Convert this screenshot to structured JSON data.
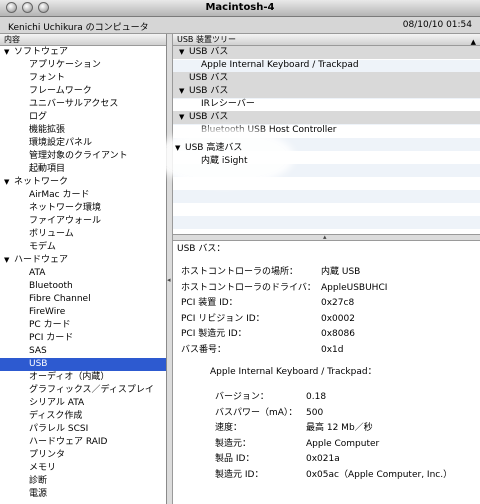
{
  "window": {
    "title": "Macintosh-4"
  },
  "info": {
    "computer_name": "Kenichi Uchikura のコンピュータ",
    "datetime": "08/10/10 01:54"
  },
  "sidebar": {
    "header": "内容",
    "rows": [
      {
        "label": "ソフトウェア",
        "cat": true
      },
      {
        "label": "アプリケーション"
      },
      {
        "label": "フォント"
      },
      {
        "label": "フレームワーク"
      },
      {
        "label": "ユニバーサルアクセス"
      },
      {
        "label": "ログ"
      },
      {
        "label": "機能拡張"
      },
      {
        "label": "環境設定パネル"
      },
      {
        "label": "管理対象のクライアント"
      },
      {
        "label": "起動項目"
      },
      {
        "label": "ネットワーク",
        "cat": true
      },
      {
        "label": "AirMac カード"
      },
      {
        "label": "ネットワーク環境"
      },
      {
        "label": "ファイアウォール"
      },
      {
        "label": "ボリューム"
      },
      {
        "label": "モデム"
      },
      {
        "label": "ハードウェア",
        "cat": true
      },
      {
        "label": "ATA"
      },
      {
        "label": "Bluetooth"
      },
      {
        "label": "Fibre Channel"
      },
      {
        "label": "FireWire"
      },
      {
        "label": "PC カード"
      },
      {
        "label": "PCI カード"
      },
      {
        "label": "SAS"
      },
      {
        "label": "USB",
        "selected": true
      },
      {
        "label": "オーディオ（内蔵）"
      },
      {
        "label": "グラフィックス／ディスプレイ"
      },
      {
        "label": "シリアル ATA"
      },
      {
        "label": "ディスク作成"
      },
      {
        "label": "パラレル SCSI"
      },
      {
        "label": "ハードウェア RAID"
      },
      {
        "label": "プリンタ"
      },
      {
        "label": "メモリ"
      },
      {
        "label": "診断"
      },
      {
        "label": "電源"
      }
    ]
  },
  "usb_tree": {
    "header": "USB 装置ツリー",
    "rows": [
      {
        "label": "USB バス",
        "type": "bus",
        "expanded": true
      },
      {
        "label": "Apple Internal Keyboard / Trackpad",
        "type": "dev"
      },
      {
        "label": "USB バス",
        "type": "bus",
        "expanded": false
      },
      {
        "label": "USB バス",
        "type": "bus",
        "expanded": true
      },
      {
        "label": "IRレシーバー",
        "type": "dev"
      },
      {
        "label": "USB バス",
        "type": "bus",
        "expanded": true
      },
      {
        "label": "Bluetooth USB Host Controller",
        "type": "dev"
      }
    ],
    "highlight": {
      "bus": "USB 高速バス",
      "device": "内蔵 iSight"
    }
  },
  "details": {
    "title": "USB バス：",
    "bus_props": [
      {
        "k": "ホストコントローラの場所：",
        "v": "内蔵 USB"
      },
      {
        "k": "ホストコントローラのドライバ：",
        "v": "AppleUSBUHCI"
      },
      {
        "k": "PCI 装置 ID：",
        "v": "0x27c8"
      },
      {
        "k": "PCI リビジョン ID：",
        "v": "0x0002"
      },
      {
        "k": "PCI 製造元 ID：",
        "v": "0x8086"
      },
      {
        "k": "バス番号：",
        "v": "0x1d"
      }
    ],
    "device_title": "Apple Internal Keyboard / Trackpad：",
    "device_props": [
      {
        "k": "バージョン：",
        "v": "0.18"
      },
      {
        "k": "バスパワー（mA）：",
        "v": "500"
      },
      {
        "k": "速度：",
        "v": "最高 12 Mb／秒"
      },
      {
        "k": "製造元：",
        "v": "Apple Computer"
      },
      {
        "k": "製品 ID：",
        "v": "0x021a"
      },
      {
        "k": "製造元 ID：",
        "v": "0x05ac（Apple Computer, Inc.）"
      }
    ]
  }
}
